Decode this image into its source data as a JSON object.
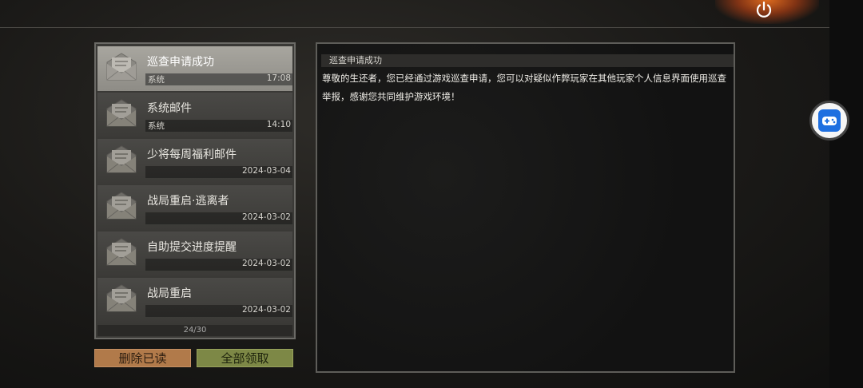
{
  "mail_list": {
    "items": [
      {
        "title": "巡查申请成功",
        "sender": "系统",
        "time": "17:08",
        "selected": true
      },
      {
        "title": "系统邮件",
        "sender": "系统",
        "time": "14:10",
        "selected": false
      },
      {
        "title": "少将每周福利邮件",
        "sender": "",
        "time": "2024-03-04",
        "selected": false
      },
      {
        "title": "战局重启·逃离者",
        "sender": "",
        "time": "2024-03-02",
        "selected": false
      },
      {
        "title": "自助提交进度提醒",
        "sender": "",
        "time": "2024-03-02",
        "selected": false
      },
      {
        "title": "战局重启",
        "sender": "",
        "time": "2024-03-02",
        "selected": false
      }
    ],
    "pager": "24/30"
  },
  "buttons": {
    "delete_read": "删除已读",
    "claim_all": "全部领取"
  },
  "detail": {
    "title": "巡查申请成功",
    "body": "尊敬的生还者，您已经通过游戏巡查申请，您可以对疑似作弊玩家在其他玩家个人信息界面使用巡查举报，感谢您共同维护游戏环境！"
  },
  "colors": {
    "delete_button": "#b17a4a",
    "claim_button": "#7d8846",
    "gamepad_accent": "#1e6fe0",
    "power_glow": "#e66e1e"
  },
  "icons": {
    "mail": "envelope-letter-icon",
    "power": "power-icon",
    "gamepad": "gamepad-icon"
  }
}
